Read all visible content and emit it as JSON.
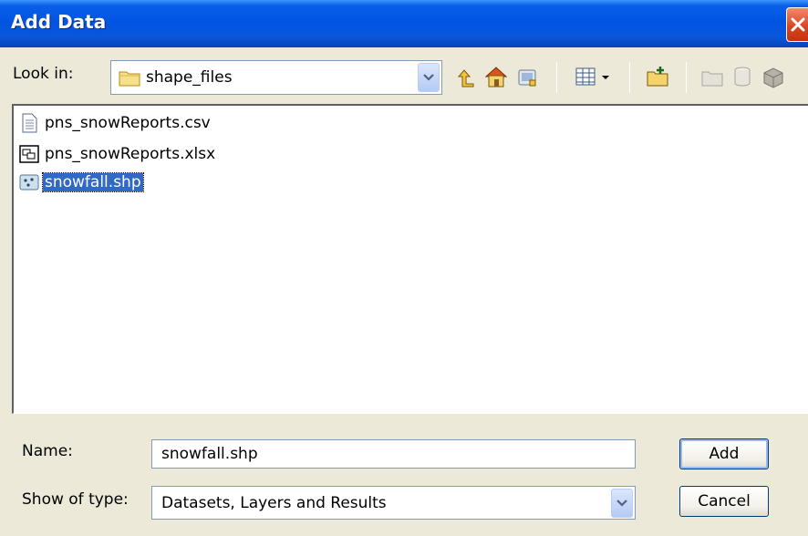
{
  "window": {
    "title": "Add Data"
  },
  "look_in": {
    "label": "Look in:",
    "value": "shape_files"
  },
  "toolbar": {
    "icons": [
      "up-one-level-icon",
      "home-icon",
      "connect-folder-icon",
      "view-options-icon",
      "new-folder-icon",
      "disconnect-folder-icon",
      "database-icon",
      "toolbox-icon"
    ]
  },
  "files": [
    {
      "name": "pns_snowReports.csv",
      "icon": "text-file-icon",
      "selected": false
    },
    {
      "name": "pns_snowReports.xlsx",
      "icon": "table-file-icon",
      "selected": false
    },
    {
      "name": "snowfall.shp",
      "icon": "point-shapefile-icon",
      "selected": true
    }
  ],
  "name_field": {
    "label": "Name:",
    "value": "snowfall.shp"
  },
  "type_field": {
    "label": "Show of type:",
    "value": "Datasets, Layers and Results"
  },
  "buttons": {
    "add": "Add",
    "cancel": "Cancel"
  },
  "colors": {
    "title_bar": "#0054e3",
    "selection": "#316ac5",
    "dialog_bg": "#ece9d8"
  }
}
